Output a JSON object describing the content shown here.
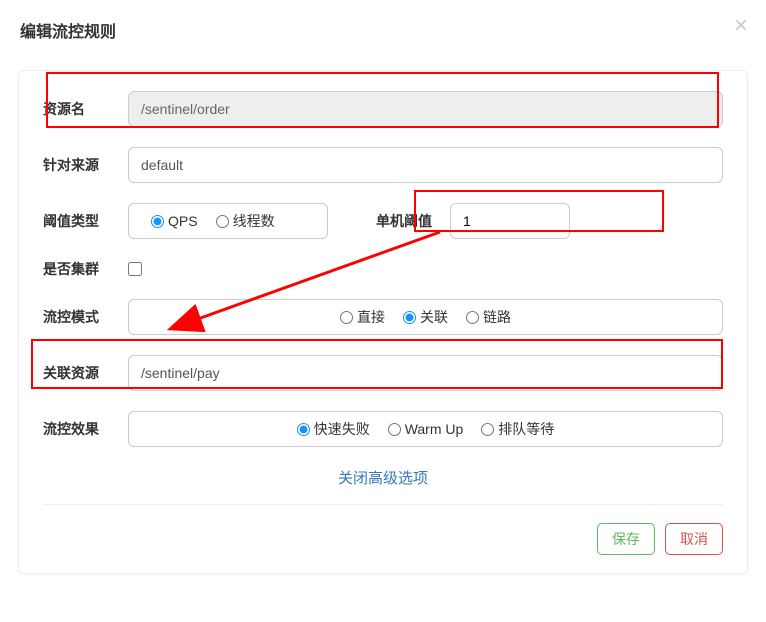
{
  "modal": {
    "title": "编辑流控规则",
    "close_advanced": "关闭高级选项"
  },
  "labels": {
    "resource": "资源名",
    "source": "针对来源",
    "threshold_type": "阈值类型",
    "threshold_value": "单机阈值",
    "cluster": "是否集群",
    "mode": "流控模式",
    "related_resource": "关联资源",
    "effect": "流控效果"
  },
  "values": {
    "resource": "/sentinel/order",
    "source": "default",
    "threshold_value": "1",
    "related_resource": "/sentinel/pay"
  },
  "radios": {
    "threshold_type": {
      "qps": "QPS",
      "threads": "线程数"
    },
    "mode": {
      "direct": "直接",
      "related": "关联",
      "chain": "链路"
    },
    "effect": {
      "fast_fail": "快速失败",
      "warm_up": "Warm Up",
      "queue": "排队等待"
    }
  },
  "buttons": {
    "save": "保存",
    "cancel": "取消"
  }
}
